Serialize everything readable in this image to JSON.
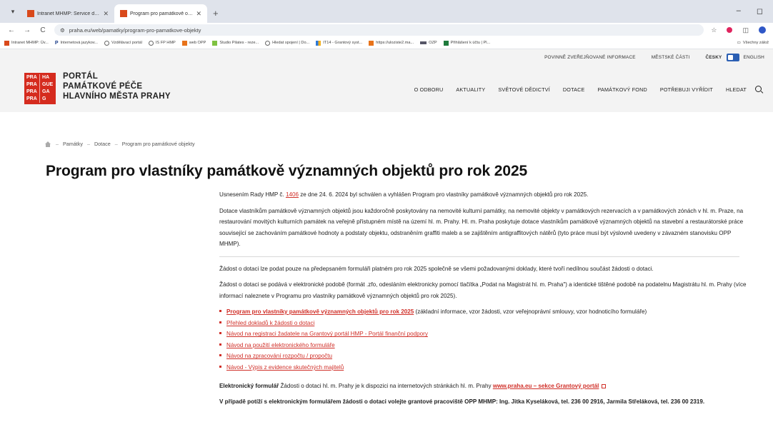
{
  "browser": {
    "tabs": [
      {
        "title": "Intranet MHMP: Service desk -",
        "active": false
      },
      {
        "title": "Program pro památkově objek",
        "active": true
      }
    ],
    "new_tab": "+",
    "window_controls": [
      "–",
      "◻"
    ],
    "url": "praha.eu/web/pamatky/program-pro-pamatkove-objekty",
    "nav": {
      "back": "←",
      "forward": "→",
      "reload": "C"
    }
  },
  "bookmarks": {
    "items": [
      {
        "label": "Intranet MHMP: Úv...",
        "icon": "red-square-icon"
      },
      {
        "label": "Internetová jazykov...",
        "icon": "p-letter-icon"
      },
      {
        "label": "Vzdělávací portál",
        "icon": "globe-icon"
      },
      {
        "label": "IS FP HMP",
        "icon": "globe-icon"
      },
      {
        "label": "web OPP",
        "icon": "orange-square-icon"
      },
      {
        "label": "Studio Pilates - reze...",
        "icon": "green-square-icon"
      },
      {
        "label": "Hledat spojení | Do...",
        "icon": "globe-icon"
      },
      {
        "label": "IT14 - Grantový syst...",
        "icon": "grid-icon"
      },
      {
        "label": "https://uloziste2.ma...",
        "icon": "orange-square-icon"
      },
      {
        "label": "OZP",
        "icon": "ozp-icon"
      },
      {
        "label": "Přihlášení k účtu | Pl...",
        "icon": "x-icon"
      }
    ],
    "all_bookmarks": "Všechny zálož"
  },
  "utility": {
    "public_info": "POVINNĚ ZVEŘEJŇOVANÉ INFORMACE",
    "districts": "MĚSTSKÉ ČÁSTI",
    "lang_cz": "ČESKY",
    "lang_en": "ENGLISH"
  },
  "logo": {
    "cells": [
      "PRA",
      "HA",
      "PRA",
      "GUE",
      "PRA",
      "GA",
      "PRA",
      "G"
    ]
  },
  "portal_title": {
    "line1": "PORTÁL",
    "line2": "PAMÁTKOVÉ PÉČE",
    "line3": "HLAVNÍHO MĚSTA PRAHY"
  },
  "nav": {
    "items": [
      "O ODBORU",
      "AKTUALITY",
      "SVĚTOVÉ DĚDICTVÍ",
      "DOTACE",
      "PAMÁTKOVÝ FOND",
      "POTŘEBUJI VYŘÍDIT",
      "HLEDAT"
    ]
  },
  "breadcrumb": {
    "items": [
      "Památky",
      "Dotace",
      "Program pro památkové objekty"
    ],
    "sep": "–"
  },
  "headline": "Program pro vlastníky památkově významných objektů pro rok 2025",
  "content": {
    "p1_before": "Usnesením Rady HMP č. ",
    "p1_link": "1406",
    "p1_after": " ze dne 24. 6. 2024 byl schválen a vyhlášen Program pro vlastníky památkově významných objektů pro rok 2025.",
    "p2": "Dotace vlastníkům památkově významných objektů jsou každoročně poskytovány na nemovité kulturní památky, na nemovité objekty v památkových rezervacích a v památkových zónách v hl. m. Praze, na restaurování movitých kulturních památek na veřejně přístupném místě na území hl. m. Prahy. Hl. m. Praha poskytuje dotace vlastníkům památkově významných objektů na stavební a restaurátorské práce související se zachováním památkové hodnoty a podstaty objektu, odstraněním graffiti maleb a se zajištěním antigraffitových nátěrů (tyto práce musí být výslovně uvedeny v závazném stanovisku OPP MHMP).",
    "p3": "Žádost o dotaci lze podat pouze na předepsaném formuláři platném pro rok 2025 společně se všemi požadovanými doklady, které tvoří nedílnou součást žádosti o dotaci.",
    "p4": "Žádost o dotaci se podává v elektronické podobě (formát .zfo, odesláním elektronicky pomocí tlačítka „Podat na Magistrát hl. m. Praha\") a identické tištěné podobě na podatelnu Magistrátu hl. m. Prahy (více informací naleznete v Programu pro vlastníky památkově významných objektů pro rok 2025).",
    "link1": "Program pro vlastníky památkově významných objektů pro rok 2025",
    "link1_after": " (základní informace, vzor žádosti, vzor veřejnoprávní smlouvy, vzor hodnoticího formuláře)",
    "link2": "Přehled dokladů k žádosti o dotaci",
    "link3": "Návod na registraci žadatele na Grantový portál HMP - Portál finanční podpory",
    "link4": "Návod na použití elektronického formuláře",
    "link5": "Návod na zpracování rozpočtu / propočtu",
    "link6": "Návod - Výpis z evidence skutečných majitelů",
    "ef_label": "Elektronický formulář",
    "ef_text": " Žádosti o dotaci hl. m. Prahy je k dispozici na internetových stránkách hl. m. Prahy ",
    "ef_link": "www.praha.eu – sekce Grantový portál",
    "contact": "V případě potíží s elektronickým formulářem žádosti o dotaci volejte grantové pracoviště OPP MHMP: Ing. Jitka Kyseláková, tel. 236 00 2916, Jarmila Střeláková, tel. 236 00 2319."
  }
}
